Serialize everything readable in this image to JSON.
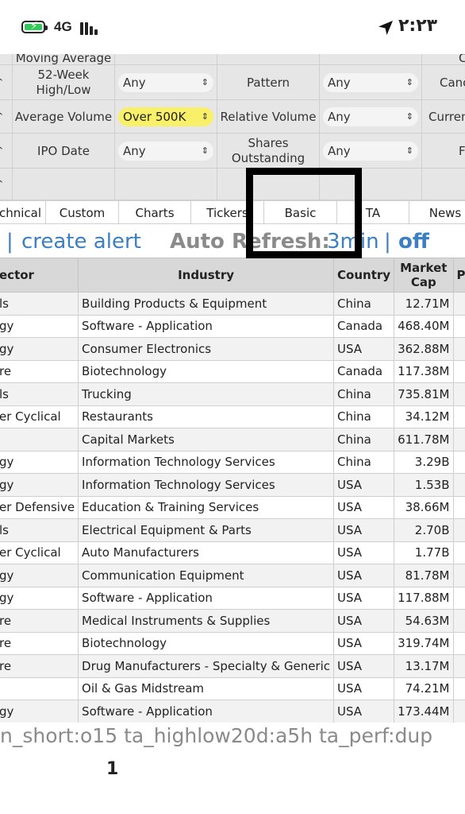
{
  "status_bar": {
    "network": "4G",
    "time": "٢:٢٣",
    "icons": [
      "battery-charging-icon",
      "signal-bars-icon",
      "location-arrow-icon"
    ]
  },
  "filters": {
    "row0": {
      "label1": "Moving Average",
      "label2": "",
      "label3": "C"
    },
    "row1": {
      "label1": "52-Week High/Low",
      "value1": "Any",
      "label2": "Pattern",
      "value2": "Any",
      "label3": "Canc"
    },
    "row2": {
      "label1": "Average Volume",
      "value1": "Over 500K",
      "label2": "Relative Volume",
      "value2": "Any",
      "label3": "Curren"
    },
    "row3": {
      "label1": "IPO Date",
      "value1": "Any",
      "label2": "Shares Outstanding",
      "value2": "Any",
      "label3": "F"
    }
  },
  "tabs": [
    "chnical",
    "Custom",
    "Charts",
    "Tickers",
    "Basic",
    "TA",
    "News"
  ],
  "alert_line": {
    "separator": "|",
    "create_alert": "create alert",
    "auto_refresh": "Auto Refresh:",
    "interval": "3min",
    "pipe": "|",
    "off": "off"
  },
  "table": {
    "headers": [
      "ector",
      "Industry",
      "Country",
      "Market Cap",
      "P/E"
    ],
    "rows": [
      {
        "sector": "ls",
        "industry": "Building Products & Equipment",
        "country": "China",
        "mcap": "12.71M",
        "pe": "-"
      },
      {
        "sector": "gy",
        "industry": "Software - Application",
        "country": "Canada",
        "mcap": "468.40M",
        "pe": "-"
      },
      {
        "sector": "gy",
        "industry": "Consumer Electronics",
        "country": "USA",
        "mcap": "362.88M",
        "pe": "-"
      },
      {
        "sector": "re",
        "industry": "Biotechnology",
        "country": "Canada",
        "mcap": "117.38M",
        "pe": "-"
      },
      {
        "sector": "ls",
        "industry": "Trucking",
        "country": "China",
        "mcap": "735.81M",
        "pe": "-"
      },
      {
        "sector": "er Cyclical",
        "industry": "Restaurants",
        "country": "China",
        "mcap": "34.12M",
        "pe": "-"
      },
      {
        "sector": "",
        "industry": "Capital Markets",
        "country": "China",
        "mcap": "611.78M",
        "pe": "-"
      },
      {
        "sector": "gy",
        "industry": "Information Technology Services",
        "country": "China",
        "mcap": "3.29B",
        "pe": "-"
      },
      {
        "sector": "gy",
        "industry": "Information Technology Services",
        "country": "USA",
        "mcap": "1.53B",
        "pe": "-"
      },
      {
        "sector": "er Defensive",
        "industry": "Education & Training Services",
        "country": "USA",
        "mcap": "38.66M",
        "pe": "-"
      },
      {
        "sector": "ls",
        "industry": "Electrical Equipment & Parts",
        "country": "USA",
        "mcap": "2.70B",
        "pe": "-"
      },
      {
        "sector": "er Cyclical",
        "industry": "Auto Manufacturers",
        "country": "USA",
        "mcap": "1.77B",
        "pe": "-"
      },
      {
        "sector": "gy",
        "industry": "Communication Equipment",
        "country": "USA",
        "mcap": "81.78M",
        "pe": "-"
      },
      {
        "sector": "gy",
        "industry": "Software - Application",
        "country": "USA",
        "mcap": "117.88M",
        "pe": "-"
      },
      {
        "sector": "re",
        "industry": "Medical Instruments & Supplies",
        "country": "USA",
        "mcap": "54.63M",
        "pe": "-"
      },
      {
        "sector": "re",
        "industry": "Biotechnology",
        "country": "USA",
        "mcap": "319.74M",
        "pe": "-"
      },
      {
        "sector": "re",
        "industry": "Drug Manufacturers - Specialty & Generic",
        "country": "USA",
        "mcap": "13.17M",
        "pe": "-"
      },
      {
        "sector": "",
        "industry": "Oil & Gas Midstream",
        "country": "USA",
        "mcap": "74.21M",
        "pe": "-"
      },
      {
        "sector": "gy",
        "industry": "Software - Application",
        "country": "USA",
        "mcap": "173.44M",
        "pe": "-"
      }
    ]
  },
  "footer": {
    "filter_string": "n_short:o15 ta_highlow20d:a5h ta_perf:dup",
    "page": "1"
  },
  "colors": {
    "link_blue": "#3a7fc1",
    "highlight_yellow": "#f9f06a",
    "filter_bg": "#e6e6e6"
  }
}
